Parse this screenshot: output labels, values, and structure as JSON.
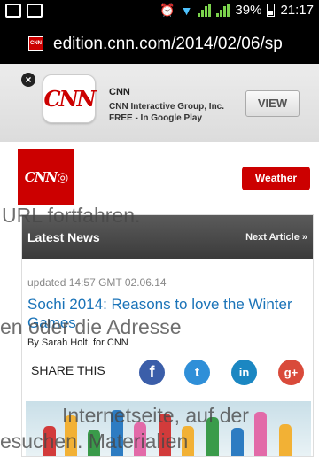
{
  "status_bar": {
    "battery": "39%",
    "time": "21:17"
  },
  "browser": {
    "url": "edition.cnn.com/2014/02/06/sp"
  },
  "ad": {
    "app_name": "CNN",
    "company": "CNN Interactive Group, Inc.",
    "store_info": "FREE - In Google Play",
    "view_button": "VIEW"
  },
  "header": {
    "weather_button": "Weather"
  },
  "news": {
    "section_title": "Latest News",
    "next_article": "Next Article »",
    "updated": "updated 14:57 GMT 02.06.14",
    "headline": "Sochi 2014: Reasons to love the Winter Games",
    "byline": "By Sarah Holt, for CNN",
    "share_label": "SHARE THIS"
  },
  "overlay_text": {
    "line1": "URL fortfahren.",
    "line2": "en oder die Adresse",
    "line3": "Internetseite, auf der",
    "line4": "esuchen. Materialien"
  },
  "colors": {
    "cnn_red": "#cc0000",
    "link_blue": "#1a73b8",
    "facebook": "#3b5ea9",
    "twitter": "#2f8fd8",
    "linkedin": "#1b87c2",
    "google_plus": "#d94a3a"
  },
  "icons": {
    "notification": "picture-icon",
    "mail": "gmail-icon",
    "alarm": "alarm-icon",
    "wifi": "wifi-icon",
    "signal": "signal-icon",
    "battery": "battery-icon",
    "close": "close-icon",
    "share": [
      "facebook-icon",
      "twitter-icon",
      "linkedin-icon",
      "google-plus-icon"
    ]
  }
}
